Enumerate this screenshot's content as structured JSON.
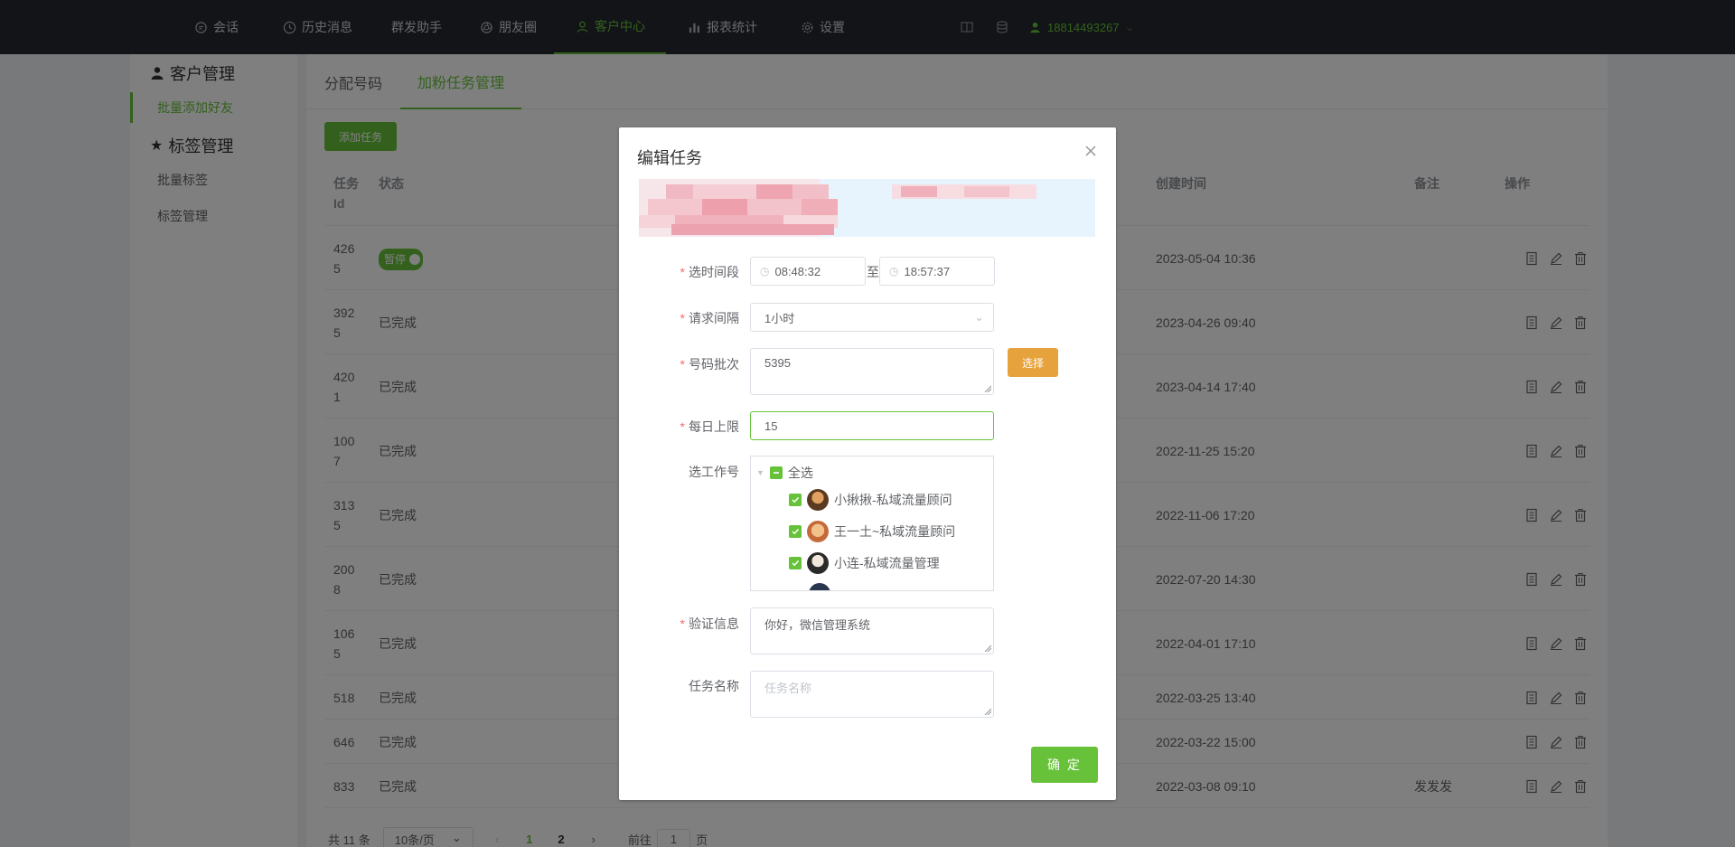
{
  "nav": {
    "items": [
      {
        "label": "会话",
        "icon": "chat-icon"
      },
      {
        "label": "历史消息",
        "icon": "clock-icon"
      },
      {
        "label": "群发助手",
        "icon": ""
      },
      {
        "label": "朋友圈",
        "icon": "aperture-icon"
      },
      {
        "label": "客户中心",
        "icon": "user-icon",
        "active": true
      },
      {
        "label": "报表统计",
        "icon": "bar-chart-icon"
      },
      {
        "label": "设置",
        "icon": "gear-icon"
      }
    ],
    "phone": "18814493267"
  },
  "sidebar": {
    "group1": "客户管理",
    "link1": "批量添加好友",
    "group2": "标签管理",
    "link2": "批量标签",
    "link3": "标签管理"
  },
  "main": {
    "tabs": [
      "分配号码",
      "加粉任务管理"
    ],
    "add_button": "添加任务",
    "headers": {
      "id": "任务Id",
      "status": "状态",
      "created": "创建时间",
      "remark": "备注",
      "ops": "操作"
    },
    "rows": [
      {
        "id": "4265",
        "status": "暂停",
        "created": "2023-05-04 10:36",
        "remark": ""
      },
      {
        "id": "3925",
        "status": "已完成",
        "created": "2023-04-26 09:40",
        "remark": ""
      },
      {
        "id": "4201",
        "status": "已完成",
        "created": "2023-04-14 17:40",
        "remark": ""
      },
      {
        "id": "1007",
        "status": "已完成",
        "created": "2022-11-25 15:20",
        "remark": ""
      },
      {
        "id": "3135",
        "status": "已完成",
        "created": "2022-11-06 17:20",
        "remark": ""
      },
      {
        "id": "2008",
        "status": "已完成",
        "created": "2022-07-20 14:30",
        "remark": ""
      },
      {
        "id": "1065",
        "status": "已完成",
        "created": "2022-04-01 17:10",
        "remark": ""
      },
      {
        "id": "518",
        "status": "已完成",
        "created": "2022-03-25 13:40",
        "remark": ""
      },
      {
        "id": "646",
        "status": "已完成",
        "created": "2022-03-22 15:00",
        "remark": ""
      },
      {
        "id": "833",
        "status": "已完成",
        "created": "2022-03-08 09:10",
        "remark": "发发发"
      }
    ],
    "pager": {
      "total": "共 11 条",
      "size": "10条/页",
      "page1": "1",
      "page2": "2",
      "goto": "前往",
      "goto_value": "1",
      "page_unit": "页"
    }
  },
  "dialog": {
    "title": "编辑任务",
    "labels": {
      "time_range": "选时间段",
      "interval": "请求间隔",
      "batch": "号码批次",
      "daily_limit": "每日上限",
      "workers": "选工作号",
      "verify": "验证信息",
      "task_name": "任务名称"
    },
    "time_start": "08:48:32",
    "time_sep": "至",
    "time_end": "18:57:37",
    "interval_value": "1小时",
    "batch_value": "5395",
    "select_button": "选择",
    "daily_limit_value": "15",
    "tree": {
      "all": "全选",
      "items": [
        "小揪揪-私域流量顾问",
        "王一土~私域流量顾问",
        "小连-私域流量管理"
      ]
    },
    "verify_value": "你好，微信管理系统",
    "task_name_placeholder": "任务名称",
    "confirm_button": "确 定"
  }
}
